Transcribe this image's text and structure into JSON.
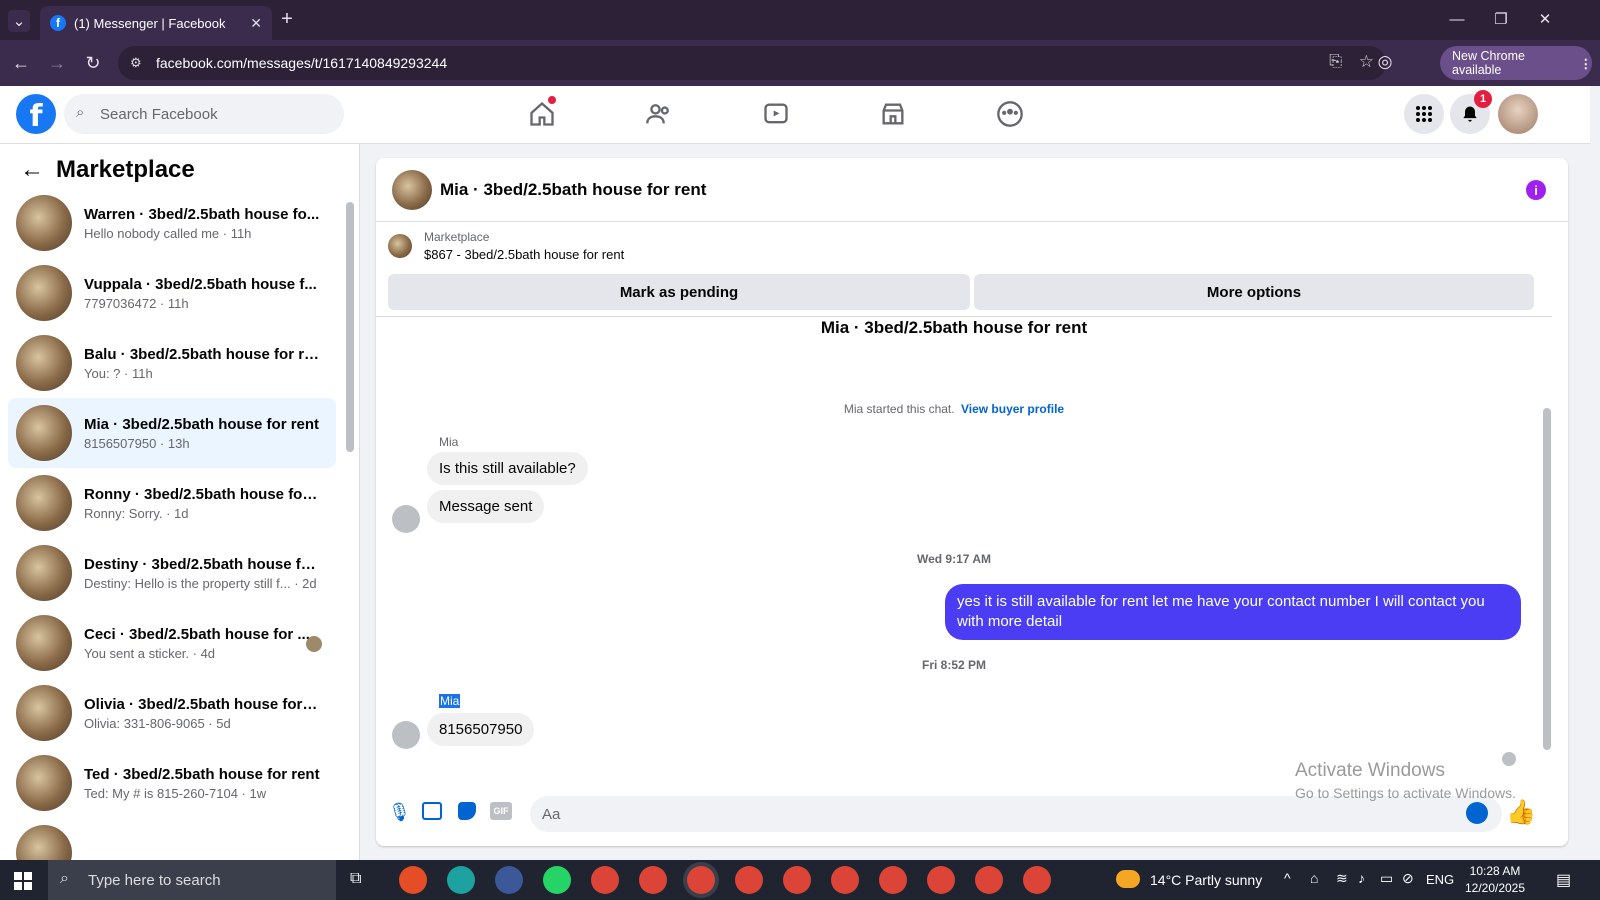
{
  "browser": {
    "tab_title": "(1) Messenger | Facebook",
    "url": "facebook.com/messages/t/1617140849293244",
    "update_label": "New Chrome available"
  },
  "fb": {
    "search_placeholder": "Search Facebook",
    "notification_count": "1"
  },
  "sidebar": {
    "title": "Marketplace",
    "conversations": [
      {
        "name": "Warren · 3bed/2.5bath house fo...",
        "preview": "Hello nobody called me · 11h"
      },
      {
        "name": "Vuppala · 3bed/2.5bath house f...",
        "preview": "7797036472 · 11h"
      },
      {
        "name": "Balu · 3bed/2.5bath house for re...",
        "preview": "You: ? · 11h"
      },
      {
        "name": "Mia · 3bed/2.5bath house for rent",
        "preview": "8156507950 · 13h"
      },
      {
        "name": "Ronny · 3bed/2.5bath house for ...",
        "preview": "Ronny: Sorry. · 1d"
      },
      {
        "name": "Destiny · 3bed/2.5bath house fo...",
        "preview": "Destiny: Hello is the property still f...  · 2d"
      },
      {
        "name": "Ceci · 3bed/2.5bath house for ...",
        "preview": "You sent a sticker. · 4d"
      },
      {
        "name": "Olivia · 3bed/2.5bath house for r...",
        "preview": "Olivia: 331-806-9065 · 5d"
      },
      {
        "name": "Ted · 3bed/2.5bath house for rent",
        "preview": "Ted: My # is 815-260-7104 · 1w"
      }
    ]
  },
  "chat": {
    "header_title": "Mia · 3bed/2.5bath house for rent",
    "listing_source": "Marketplace",
    "listing_detail": "$867 - 3bed/2.5bath house for rent",
    "mark_pending": "Mark as pending",
    "more_options": "More options",
    "thread_title": "Mia · 3bed/2.5bath house for rent",
    "started_text": "Mia started this chat.",
    "view_profile": "View buyer profile",
    "sender_name": "Mia",
    "msg1": "Is this still available?",
    "msg2": "Message sent",
    "time1": "Wed 9:17 AM",
    "mine1": "yes it is still available for rent let me have your contact number I will contact you with more detail",
    "time2": "Fri 8:52 PM",
    "sender_name2": "Mia",
    "msg3": "8156507950",
    "composer_placeholder": "Aa"
  },
  "watermark": {
    "line1": "Activate Windows",
    "line2": "Go to Settings to activate Windows."
  },
  "taskbar": {
    "search_placeholder": "Type here to search",
    "weather": "14°C  Partly sunny",
    "lang": "ENG",
    "time": "10:28 AM",
    "date": "12/20/2025"
  }
}
